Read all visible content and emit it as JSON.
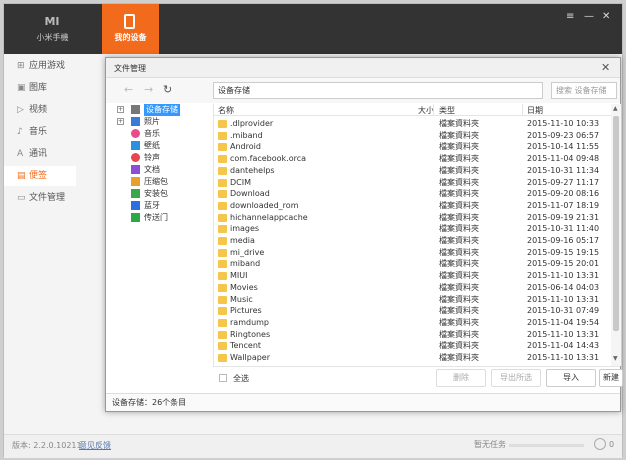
{
  "app": {
    "brand_text": "小米手機",
    "brand_logo": "MI",
    "active_tab": "我的设备",
    "accent": "#f26b1d",
    "window_controls": [
      "≡",
      "—",
      "✕"
    ]
  },
  "sidebar": {
    "items": [
      {
        "label": "应用游戏",
        "icon": "apps-icon",
        "glyph": "⊞"
      },
      {
        "label": "图库",
        "icon": "image-icon",
        "glyph": "▣"
      },
      {
        "label": "视频",
        "icon": "video-icon",
        "glyph": "▷"
      },
      {
        "label": "音乐",
        "icon": "music-icon",
        "glyph": "♪"
      },
      {
        "label": "通讯",
        "icon": "contacts-icon",
        "glyph": "A"
      },
      {
        "label": "便签",
        "icon": "notes-icon",
        "glyph": "▤"
      },
      {
        "label": "文件管理",
        "icon": "folder-icon",
        "glyph": "▭"
      }
    ]
  },
  "status": {
    "version": "版本: 2.2.0.10211",
    "feedback": "意见反馈",
    "task": "暂无任务",
    "download_count": "0"
  },
  "dialog": {
    "title": "文件管理",
    "close": "✕",
    "path": "设备存储",
    "search_placeholder": "搜索 设备存储",
    "tree": [
      {
        "label": "设备存储",
        "color": "#777777",
        "expandable": true,
        "selected": true
      },
      {
        "label": "照片",
        "color": "#3a7bd5",
        "expandable": true
      },
      {
        "label": "音乐",
        "color": "#e84d8a"
      },
      {
        "label": "壁纸",
        "color": "#2d8fe0"
      },
      {
        "label": "铃声",
        "color": "#e8454d"
      },
      {
        "label": "文档",
        "color": "#8a4fd4"
      },
      {
        "label": "压缩包",
        "color": "#e8a02d"
      },
      {
        "label": "安装包",
        "color": "#3aa74a"
      },
      {
        "label": "蓝牙",
        "color": "#2d6fe0"
      },
      {
        "label": "传送门",
        "color": "#2aa84a"
      }
    ],
    "columns": {
      "name": "名称",
      "size": "大小",
      "type": "类型",
      "date": "日期"
    },
    "files": [
      {
        "name": ".dlprovider",
        "type": "檔案資料夾",
        "date": "2015-11-10 10:33"
      },
      {
        "name": ".miband",
        "type": "檔案資料夾",
        "date": "2015-09-23 06:57"
      },
      {
        "name": "Android",
        "type": "檔案資料夾",
        "date": "2015-10-14 11:55"
      },
      {
        "name": "com.facebook.orca",
        "type": "檔案資料夾",
        "date": "2015-11-04 09:48"
      },
      {
        "name": "dantehelps",
        "type": "檔案資料夾",
        "date": "2015-10-31 11:34"
      },
      {
        "name": "DCIM",
        "type": "檔案資料夾",
        "date": "2015-09-27 11:17"
      },
      {
        "name": "Download",
        "type": "檔案資料夾",
        "date": "2015-09-20 08:16"
      },
      {
        "name": "downloaded_rom",
        "type": "檔案資料夾",
        "date": "2015-11-07 18:19"
      },
      {
        "name": "hichannelappcache",
        "type": "檔案資料夾",
        "date": "2015-09-19 21:31"
      },
      {
        "name": "images",
        "type": "檔案資料夾",
        "date": "2015-10-31 11:40"
      },
      {
        "name": "media",
        "type": "檔案資料夾",
        "date": "2015-09-16 05:17"
      },
      {
        "name": "mi_drive",
        "type": "檔案資料夾",
        "date": "2015-09-15 19:15"
      },
      {
        "name": "miband",
        "type": "檔案資料夾",
        "date": "2015-09-15 20:01"
      },
      {
        "name": "MIUI",
        "type": "檔案資料夾",
        "date": "2015-11-10 13:31"
      },
      {
        "name": "Movies",
        "type": "檔案資料夾",
        "date": "2015-06-14 04:03"
      },
      {
        "name": "Music",
        "type": "檔案資料夾",
        "date": "2015-11-10 13:31"
      },
      {
        "name": "Pictures",
        "type": "檔案資料夾",
        "date": "2015-10-31 07:49"
      },
      {
        "name": "ramdump",
        "type": "檔案資料夾",
        "date": "2015-11-04 19:54"
      },
      {
        "name": "Ringtones",
        "type": "檔案資料夾",
        "date": "2015-11-10 13:31"
      },
      {
        "name": "Tencent",
        "type": "檔案資料夾",
        "date": "2015-11-04 14:43"
      },
      {
        "name": "Wallpaper",
        "type": "檔案資料夾",
        "date": "2015-11-10 13:31"
      }
    ],
    "select_all": "全选",
    "buttons": {
      "delete": "删除",
      "export": "导出所选",
      "import": "导入",
      "new_folder": "新建文"
    },
    "status": "设备存储：26个条目"
  }
}
